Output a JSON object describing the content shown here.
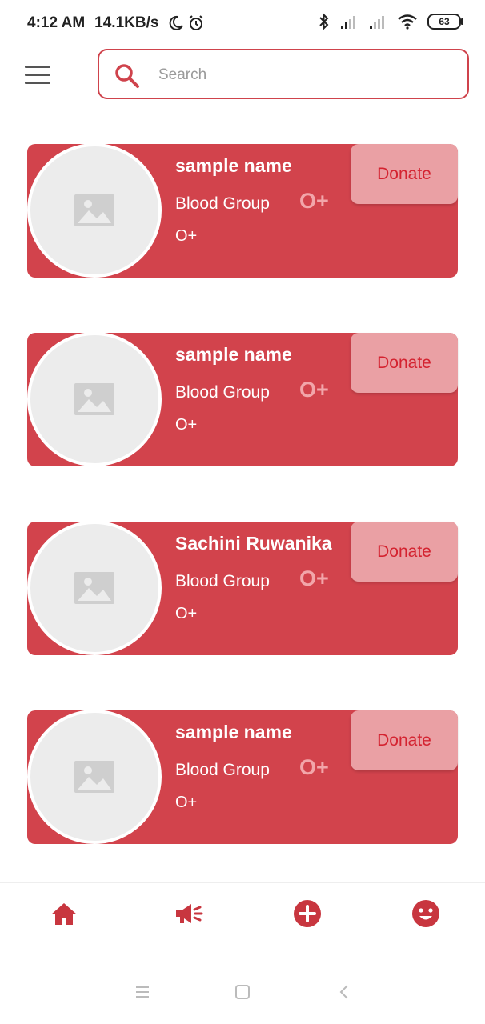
{
  "status_bar": {
    "time": "4:12 AM",
    "speed": "14.1KB/s",
    "battery": "63"
  },
  "header": {
    "search_placeholder": "Search"
  },
  "donors": [
    {
      "name": "sample name",
      "blood_group_label": "Blood Group",
      "blood_group_value": "O+",
      "blood_group_sub": "O+",
      "donate_label": "Donate"
    },
    {
      "name": "sample name",
      "blood_group_label": "Blood Group",
      "blood_group_value": "O+",
      "blood_group_sub": "O+",
      "donate_label": "Donate"
    },
    {
      "name": "Sachini Ruwanika",
      "blood_group_label": "Blood Group",
      "blood_group_value": "O+",
      "blood_group_sub": "O+",
      "donate_label": "Donate"
    },
    {
      "name": "sample name",
      "blood_group_label": "Blood Group",
      "blood_group_value": "O+",
      "blood_group_sub": "O+",
      "donate_label": "Donate"
    }
  ],
  "bottom_nav": {
    "items": [
      {
        "icon": "home-icon"
      },
      {
        "icon": "megaphone-icon"
      },
      {
        "icon": "add-circle-icon"
      },
      {
        "icon": "smiley-icon"
      }
    ]
  },
  "colors": {
    "accent": "#d2434c",
    "donate_bg": "#eaa0a4",
    "donate_text": "#d42330"
  }
}
